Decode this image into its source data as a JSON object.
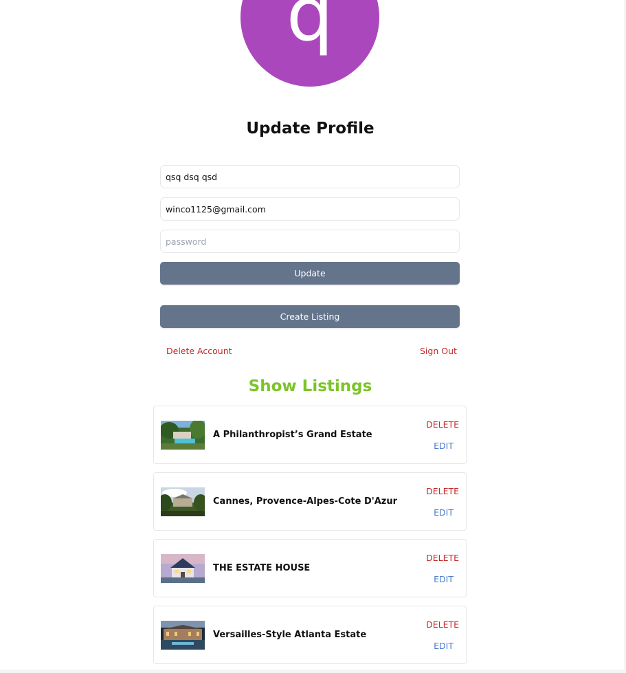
{
  "profile": {
    "avatar_letter": "q",
    "avatar_color": "#ab47bc",
    "title": "Update Profile",
    "username_value": "qsq dsq qsd",
    "email_value": "winco1125@gmail.com",
    "password_placeholder": "password",
    "update_label": "Update",
    "create_listing_label": "Create Listing",
    "delete_account_label": "Delete Account",
    "sign_out_label": "Sign Out"
  },
  "listings": {
    "section_title": "Show Listings",
    "items": [
      {
        "title": "A Philanthropist’s Grand Estate",
        "delete_label": "DELETE",
        "edit_label": "EDIT"
      },
      {
        "title": "Cannes, Provence-Alpes-Cote D'Azur",
        "delete_label": "DELETE",
        "edit_label": "EDIT"
      },
      {
        "title": "THE ESTATE HOUSE",
        "delete_label": "DELETE",
        "edit_label": "EDIT"
      },
      {
        "title": "Versailles-Style Atlanta Estate",
        "delete_label": "DELETE",
        "edit_label": "EDIT"
      }
    ]
  },
  "colors": {
    "button_bg": "#64748b",
    "danger": "#c62828",
    "edit": "#4a7bd0",
    "section_title": "#7cc42a"
  }
}
